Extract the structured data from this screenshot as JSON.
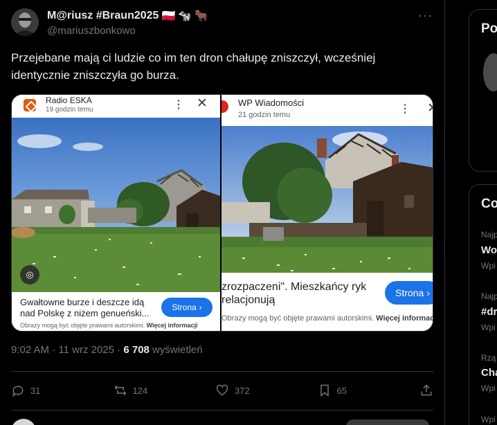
{
  "tweet": {
    "author_name": "M@riusz #Braun2025",
    "author_badges": [
      "🇵🇱",
      "🐄",
      "🐂"
    ],
    "handle": "@mariuszbonkowo",
    "text": "Przejebane mają ci ludzie co im ten dron chałupę zniszczył, wcześniej identycznie zniszczyła go burza.",
    "more_label": "···",
    "time": "9:02 AM",
    "date": "11 wrz 2025",
    "views_count": "6 708",
    "views_label": "wyświetleń",
    "separator": "·"
  },
  "media": {
    "left": {
      "source_name": "Radio ESKA",
      "source_time": "19 godzin temu",
      "menu_icon": "⋮",
      "close_icon": "✕",
      "headline": "Gwałtowne burze i deszcze idą nad Polskę z niżem genueński...",
      "button_label": "Strona",
      "button_arrow": "›",
      "copyright_text": "Obrazy mogą być objęte prawami autorskimi.",
      "copyright_link": "Więcej informacji",
      "lens_icon": "◎"
    },
    "right": {
      "source_name": "WP Wiadomości",
      "source_time": "21 godzin temu",
      "menu_icon": "⋮",
      "close_icon": "✕",
      "headline": "zrozpaczeni\". Mieszkańcy ryk relacjonują",
      "button_label": "Strona",
      "button_arrow": "›",
      "copyright_text": "Obrazy mogą być objęte prawami autorskimi.",
      "copyright_link": "Więcej informac"
    }
  },
  "actions": {
    "replies": "31",
    "reposts": "124",
    "likes": "372",
    "bookmarks": "65"
  },
  "sidebar": {
    "card1_title": "Po",
    "card2_title": "Co",
    "trends": [
      {
        "label": "Najp",
        "name": "Wo",
        "sub": "Wpi"
      },
      {
        "label": "Najp",
        "name": "#dr",
        "sub": "Wpi"
      },
      {
        "label": "Rzą",
        "name": "Cha",
        "sub": "Wpi"
      },
      {
        "label": "",
        "name": "",
        "sub": "Wpi"
      }
    ]
  },
  "colors": {
    "background": "#000000",
    "text_primary": "#e7e9ea",
    "text_secondary": "#71767b",
    "border": "#2f3336",
    "google_blue": "#1a73e8",
    "eska_orange": "#e45a12"
  }
}
